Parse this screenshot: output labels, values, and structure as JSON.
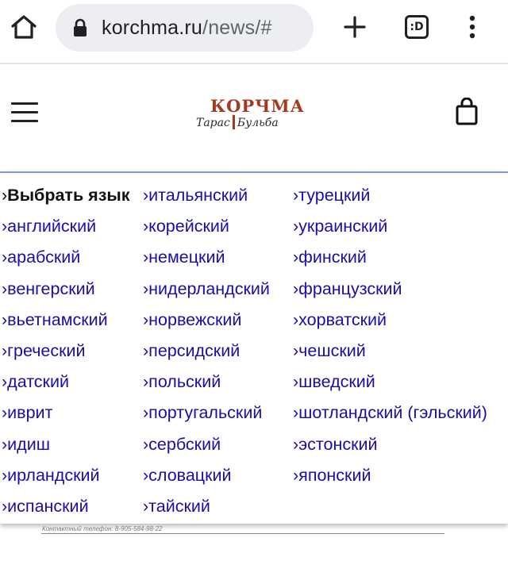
{
  "browser": {
    "url_host": "korchma.ru",
    "url_path": "/news/#",
    "tab_label": ":D"
  },
  "site": {
    "logo_title": "КОРЧМА",
    "logo_sub_left": "Тарас",
    "logo_sub_right": "Бульба"
  },
  "language_menu": {
    "arrow": "›",
    "columns": [
      [
        {
          "label": "Выбрать язык",
          "current": true
        },
        {
          "label": "английский"
        },
        {
          "label": "арабский"
        },
        {
          "label": "венгерский"
        },
        {
          "label": "вьетнамский"
        },
        {
          "label": "греческий"
        },
        {
          "label": "датский"
        },
        {
          "label": "иврит"
        },
        {
          "label": "идиш"
        },
        {
          "label": "ирландский"
        },
        {
          "label": "испанский"
        }
      ],
      [
        {
          "label": "итальянский"
        },
        {
          "label": "корейский"
        },
        {
          "label": "немецкий"
        },
        {
          "label": "нидерландский"
        },
        {
          "label": "норвежский"
        },
        {
          "label": "персидский"
        },
        {
          "label": "польский"
        },
        {
          "label": "португальский"
        },
        {
          "label": "сербский"
        },
        {
          "label": "словацкий"
        },
        {
          "label": "тайский"
        }
      ],
      [
        {
          "label": "турецкий"
        },
        {
          "label": "украинский"
        },
        {
          "label": "финский"
        },
        {
          "label": "французский"
        },
        {
          "label": "хорватский"
        },
        {
          "label": "чешский"
        },
        {
          "label": "шведский"
        },
        {
          "label": "шотландский (гэльский)"
        },
        {
          "label": "эстонский"
        },
        {
          "label": "японский"
        }
      ]
    ]
  },
  "footer": {
    "contact": "Контактный телефон: 8-905-584-98-22"
  },
  "colors": {
    "link": "#1a0dab",
    "brand": "#a33a1e",
    "panel_border": "#7e9fd6"
  },
  "icons": [
    "home-icon",
    "lock-icon",
    "plus-icon",
    "tab-switcher-icon",
    "more-vert-icon",
    "hamburger-menu-icon",
    "shopping-bag-icon"
  ]
}
